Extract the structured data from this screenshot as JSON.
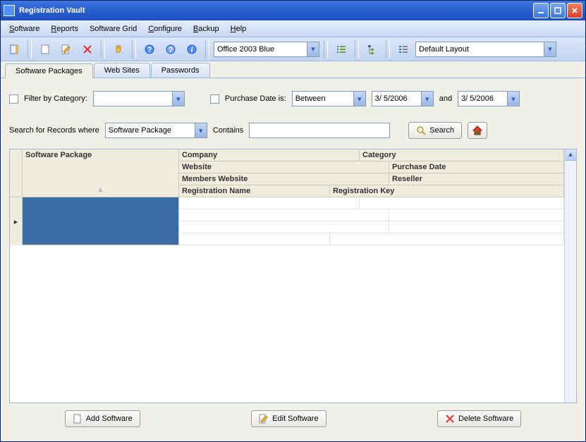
{
  "window": {
    "title": "Registration Vault"
  },
  "menu": {
    "items": [
      "Software",
      "Reports",
      "Software Grid",
      "Configure",
      "Backup",
      "Help"
    ]
  },
  "toolbar": {
    "theme_combo": "Office 2003 Blue",
    "layout_combo": "Default Layout"
  },
  "tabs": {
    "items": [
      "Software Packages",
      "Web Sites",
      "Passwords"
    ],
    "active": 0
  },
  "filter": {
    "checkbox_label": "Filter by Category:",
    "category_value": "",
    "date_checkbox_label": "Purchase Date is:",
    "date_mode": "Between",
    "date_from": "3/ 5/2006",
    "date_and": "and",
    "date_to": "3/ 5/2006"
  },
  "search": {
    "label": "Search for Records where",
    "field_combo": "Software Package",
    "match_label": "Contains",
    "value": "",
    "button": "Search"
  },
  "grid": {
    "headers": {
      "main": "Software Package",
      "r1c1": "Company",
      "r1c2": "Category",
      "r2c1": "Website",
      "r2c2": "Purchase Date",
      "r3c1": "Members Website",
      "r3c2": "Reseller",
      "r4c1": "Registration Name",
      "r4c2": "Registration Key"
    }
  },
  "footer": {
    "add": "Add Software",
    "edit": "Edit Software",
    "delete": "Delete Software"
  }
}
